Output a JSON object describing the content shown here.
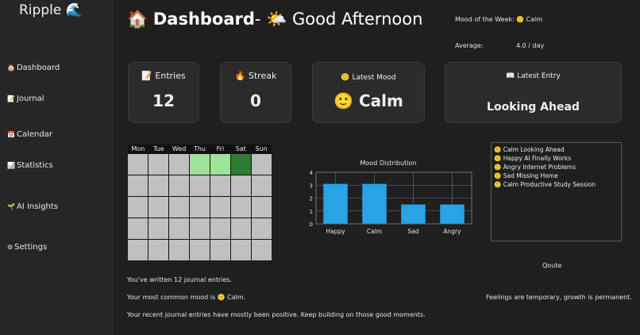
{
  "sidebar": {
    "brand": "Ripple 🌊",
    "items": [
      {
        "icon": "🏠",
        "label": "Dashboard"
      },
      {
        "icon": "📝",
        "label": "Journal"
      },
      {
        "icon": "📅",
        "label": "Calendar"
      },
      {
        "icon": "📊",
        "label": "Statistics"
      },
      {
        "icon": "🌱",
        "label": "AI Insights"
      },
      {
        "icon": "⚙",
        "label": "Settings"
      }
    ]
  },
  "header": {
    "icon": "🏠",
    "title": "Dashboard",
    "separator": "- ",
    "greeting_icon": "🌤️",
    "greeting": "Good Afternoon"
  },
  "week": {
    "mood_label": "Mood of the Week:",
    "mood_value": "🙂 Calm",
    "average_label": "Average:",
    "average_value": "4.0 / day"
  },
  "cards": {
    "entries": {
      "label": "📝 Entries",
      "value": "12"
    },
    "streak": {
      "label": "🔥 Streak",
      "value": "0"
    },
    "latest_mood": {
      "label": "🙂 Latest Mood",
      "value": "🙂 Calm"
    },
    "latest_entry": {
      "label": "📖 Latest Entry",
      "value": "Looking Ahead"
    }
  },
  "calendar": {
    "days": [
      "Mon",
      "Tue",
      "Wed",
      "Thu",
      "Fri",
      "Sat",
      "Sun"
    ],
    "colors": {
      "empty": "#c0c0c0",
      "light": "#9de39a",
      "dark": "#2e7d32"
    },
    "cells": [
      "empty",
      "empty",
      "empty",
      "light",
      "light",
      "dark",
      "empty",
      "empty",
      "empty",
      "empty",
      "empty",
      "empty",
      "empty",
      "empty",
      "empty",
      "empty",
      "empty",
      "empty",
      "empty",
      "empty",
      "empty",
      "empty",
      "empty",
      "empty",
      "empty",
      "empty",
      "empty",
      "empty",
      "empty",
      "empty",
      "empty",
      "empty",
      "empty",
      "empty",
      "empty"
    ]
  },
  "chart_data": {
    "type": "bar",
    "title": "Mood Distribution",
    "categories": [
      "Happy",
      "Calm",
      "Sad",
      "Angry"
    ],
    "values": [
      3.1,
      3.1,
      1.5,
      1.5
    ],
    "ylim": [
      0,
      4
    ],
    "yticks": [
      0,
      1,
      2,
      3,
      4
    ],
    "grid": true,
    "bar_color": "#29a3e3"
  },
  "recent_entries": [
    "🙂 Calm Looking Ahead",
    "🙂 Happy AI Finally Works",
    "🙂 Angry Internet Problems",
    "🙂 Sad Missing Home",
    "🙂 Calm Productive Study Session"
  ],
  "quote": {
    "title": "Qoute",
    "text": "Feelings are temporary, growth is permanent."
  },
  "summary": {
    "line1": "You've written 12 journal entries.",
    "line2": "Your most common mood is 🙂 Calm.",
    "line3": "Your recent journal entries have mostly been positive. Keep building on those good moments."
  }
}
